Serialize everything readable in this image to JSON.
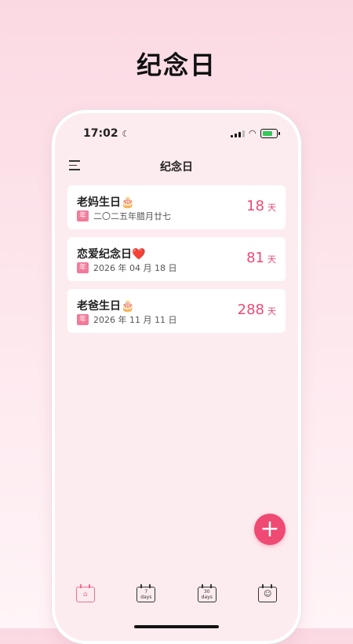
{
  "promo": {
    "title": "纪念日"
  },
  "status": {
    "time": "17:02",
    "moon": "☾"
  },
  "nav": {
    "title": "纪念日"
  },
  "items": [
    {
      "title": "老妈生日🎂",
      "tag": "年",
      "date": "二〇二五年腊月廿七",
      "days": "18",
      "unit": "天"
    },
    {
      "title": "恋爱纪念日❤️",
      "tag": "年",
      "date": "2026 年 04 月 18 日",
      "days": "81",
      "unit": "天"
    },
    {
      "title": "老爸生日🎂",
      "tag": "年",
      "date": "2026 年 11 月 11 日",
      "days": "288",
      "unit": "天"
    }
  ],
  "fab": {
    "label": "+"
  },
  "tabs": [
    {
      "icon": "calendar-home-icon",
      "line1": "⌂",
      "line2": ""
    },
    {
      "icon": "calendar-7days-icon",
      "line1": "7",
      "line2": "days"
    },
    {
      "icon": "calendar-30days-icon",
      "line1": "30",
      "line2": "days"
    },
    {
      "icon": "calendar-smile-icon",
      "line1": "☺",
      "line2": ""
    }
  ],
  "colors": {
    "accent": "#ee4a74",
    "tag": "#f47a9a",
    "screen_bg": "#fdecef"
  }
}
